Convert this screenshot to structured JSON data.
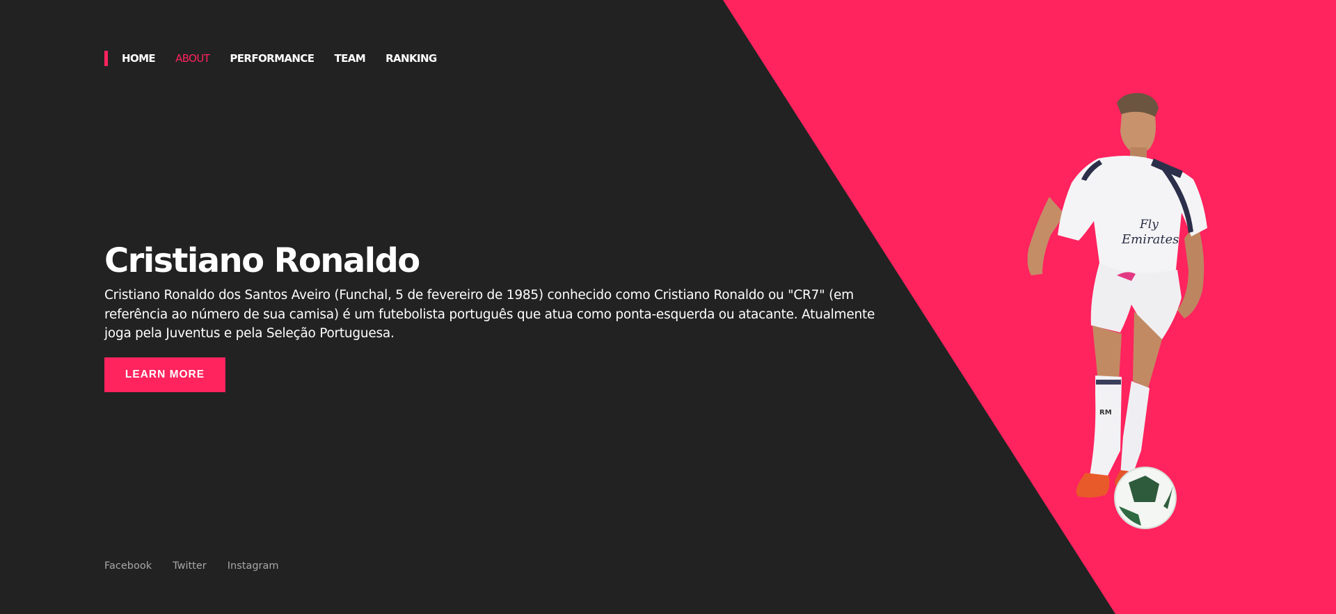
{
  "nav": {
    "items": [
      {
        "label": "HOME",
        "active": false
      },
      {
        "label": "ABOUT",
        "active": true
      },
      {
        "label": "PERFORMANCE",
        "active": false
      },
      {
        "label": "TEAM",
        "active": false
      },
      {
        "label": "RANKING",
        "active": false
      }
    ]
  },
  "hero": {
    "title": "Cristiano Ronaldo",
    "description": "Cristiano Ronaldo dos Santos Aveiro (Funchal, 5 de fevereiro de 1985) conhecido como Cristiano Ronaldo ou \"CR7\" (em referência ao número de sua camisa) é um futebolista português que atua como ponta-esquerda ou atacante. Atualmente joga pela Juventus e pela Seleção Portuguesa.",
    "cta_label": "LEARN MORE"
  },
  "social": {
    "links": [
      "Facebook",
      "Twitter",
      "Instagram"
    ]
  },
  "player_image": {
    "shirt_text_1": "Fly",
    "shirt_text_2": "Emirates",
    "sock_text": "RM"
  },
  "colors": {
    "background": "#222223",
    "accent": "#ff235e",
    "text": "#ffffff",
    "muted": "#a7a7a7"
  }
}
